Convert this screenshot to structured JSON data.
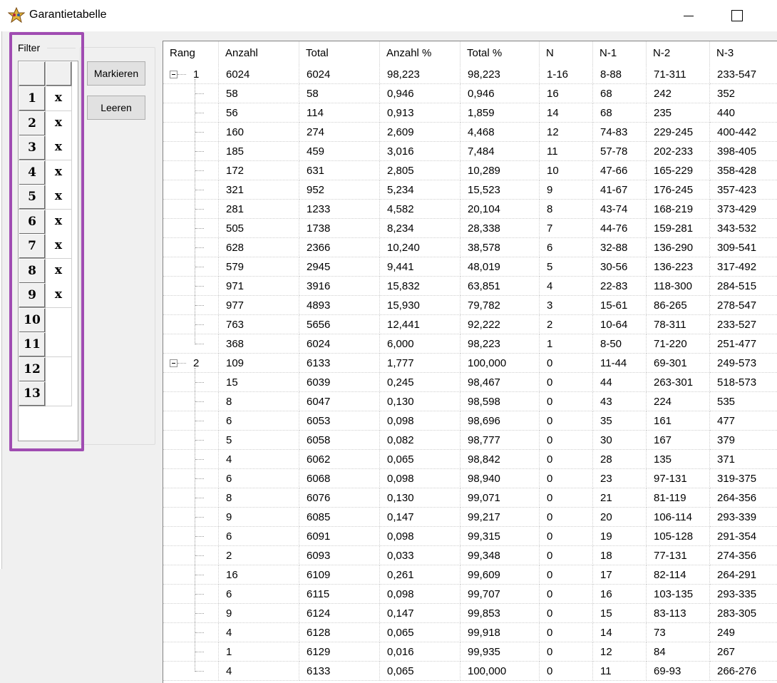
{
  "window": {
    "title": "Garantietabelle",
    "icon": "star-app-icon"
  },
  "filter": {
    "legend": "Filter",
    "rows": [
      {
        "num": "1",
        "val": "x"
      },
      {
        "num": "2",
        "val": "x"
      },
      {
        "num": "3",
        "val": "x"
      },
      {
        "num": "4",
        "val": "x"
      },
      {
        "num": "5",
        "val": "x"
      },
      {
        "num": "6",
        "val": "x"
      },
      {
        "num": "7",
        "val": "x"
      },
      {
        "num": "8",
        "val": "x"
      },
      {
        "num": "9",
        "val": "x"
      },
      {
        "num": "10",
        "val": ""
      },
      {
        "num": "11",
        "val": ""
      },
      {
        "num": "12",
        "val": ""
      },
      {
        "num": "13",
        "val": ""
      }
    ]
  },
  "buttons": {
    "mark": "Markieren",
    "clear": "Leeren"
  },
  "table": {
    "columns": [
      "Rang",
      "Anzahl",
      "Total",
      "Anzahl %",
      "Total %",
      "N",
      "N-1",
      "N-2",
      "N-3"
    ],
    "groups": [
      {
        "rank": "1",
        "row": [
          "6024",
          "6024",
          "98,223",
          "98,223",
          "1-16",
          "8-88",
          "71-311",
          "233-547"
        ],
        "children": [
          [
            "58",
            "58",
            "0,946",
            "0,946",
            "16",
            "68",
            "242",
            "352"
          ],
          [
            "56",
            "114",
            "0,913",
            "1,859",
            "14",
            "68",
            "235",
            "440"
          ],
          [
            "160",
            "274",
            "2,609",
            "4,468",
            "12",
            "74-83",
            "229-245",
            "400-442"
          ],
          [
            "185",
            "459",
            "3,016",
            "7,484",
            "11",
            "57-78",
            "202-233",
            "398-405"
          ],
          [
            "172",
            "631",
            "2,805",
            "10,289",
            "10",
            "47-66",
            "165-229",
            "358-428"
          ],
          [
            "321",
            "952",
            "5,234",
            "15,523",
            "9",
            "41-67",
            "176-245",
            "357-423"
          ],
          [
            "281",
            "1233",
            "4,582",
            "20,104",
            "8",
            "43-74",
            "168-219",
            "373-429"
          ],
          [
            "505",
            "1738",
            "8,234",
            "28,338",
            "7",
            "44-76",
            "159-281",
            "343-532"
          ],
          [
            "628",
            "2366",
            "10,240",
            "38,578",
            "6",
            "32-88",
            "136-290",
            "309-541"
          ],
          [
            "579",
            "2945",
            "9,441",
            "48,019",
            "5",
            "30-56",
            "136-223",
            "317-492"
          ],
          [
            "971",
            "3916",
            "15,832",
            "63,851",
            "4",
            "22-83",
            "118-300",
            "284-515"
          ],
          [
            "977",
            "4893",
            "15,930",
            "79,782",
            "3",
            "15-61",
            "86-265",
            "278-547"
          ],
          [
            "763",
            "5656",
            "12,441",
            "92,222",
            "2",
            "10-64",
            "78-311",
            "233-527"
          ],
          [
            "368",
            "6024",
            "6,000",
            "98,223",
            "1",
            "8-50",
            "71-220",
            "251-477"
          ]
        ]
      },
      {
        "rank": "2",
        "row": [
          "109",
          "6133",
          "1,777",
          "100,000",
          "0",
          "11-44",
          "69-301",
          "249-573"
        ],
        "children": [
          [
            "15",
            "6039",
            "0,245",
            "98,467",
            "0",
            "44",
            "263-301",
            "518-573"
          ],
          [
            "8",
            "6047",
            "0,130",
            "98,598",
            "0",
            "43",
            "224",
            "535"
          ],
          [
            "6",
            "6053",
            "0,098",
            "98,696",
            "0",
            "35",
            "161",
            "477"
          ],
          [
            "5",
            "6058",
            "0,082",
            "98,777",
            "0",
            "30",
            "167",
            "379"
          ],
          [
            "4",
            "6062",
            "0,065",
            "98,842",
            "0",
            "28",
            "135",
            "371"
          ],
          [
            "6",
            "6068",
            "0,098",
            "98,940",
            "0",
            "23",
            "97-131",
            "319-375"
          ],
          [
            "8",
            "6076",
            "0,130",
            "99,071",
            "0",
            "21",
            "81-119",
            "264-356"
          ],
          [
            "9",
            "6085",
            "0,147",
            "99,217",
            "0",
            "20",
            "106-114",
            "293-339"
          ],
          [
            "6",
            "6091",
            "0,098",
            "99,315",
            "0",
            "19",
            "105-128",
            "291-354"
          ],
          [
            "2",
            "6093",
            "0,033",
            "99,348",
            "0",
            "18",
            "77-131",
            "274-356"
          ],
          [
            "16",
            "6109",
            "0,261",
            "99,609",
            "0",
            "17",
            "82-114",
            "264-291"
          ],
          [
            "6",
            "6115",
            "0,098",
            "99,707",
            "0",
            "16",
            "103-135",
            "293-335"
          ],
          [
            "9",
            "6124",
            "0,147",
            "99,853",
            "0",
            "15",
            "83-113",
            "283-305"
          ],
          [
            "4",
            "6128",
            "0,065",
            "99,918",
            "0",
            "14",
            "73",
            "249"
          ],
          [
            "1",
            "6129",
            "0,016",
            "99,935",
            "0",
            "12",
            "84",
            "267"
          ],
          [
            "4",
            "6133",
            "0,065",
            "100,000",
            "0",
            "11",
            "69-93",
            "266-276"
          ]
        ]
      }
    ]
  },
  "colors": {
    "highlight": "#a04cb2",
    "button": "#e1e1e1",
    "window": "#f0f0f0"
  }
}
